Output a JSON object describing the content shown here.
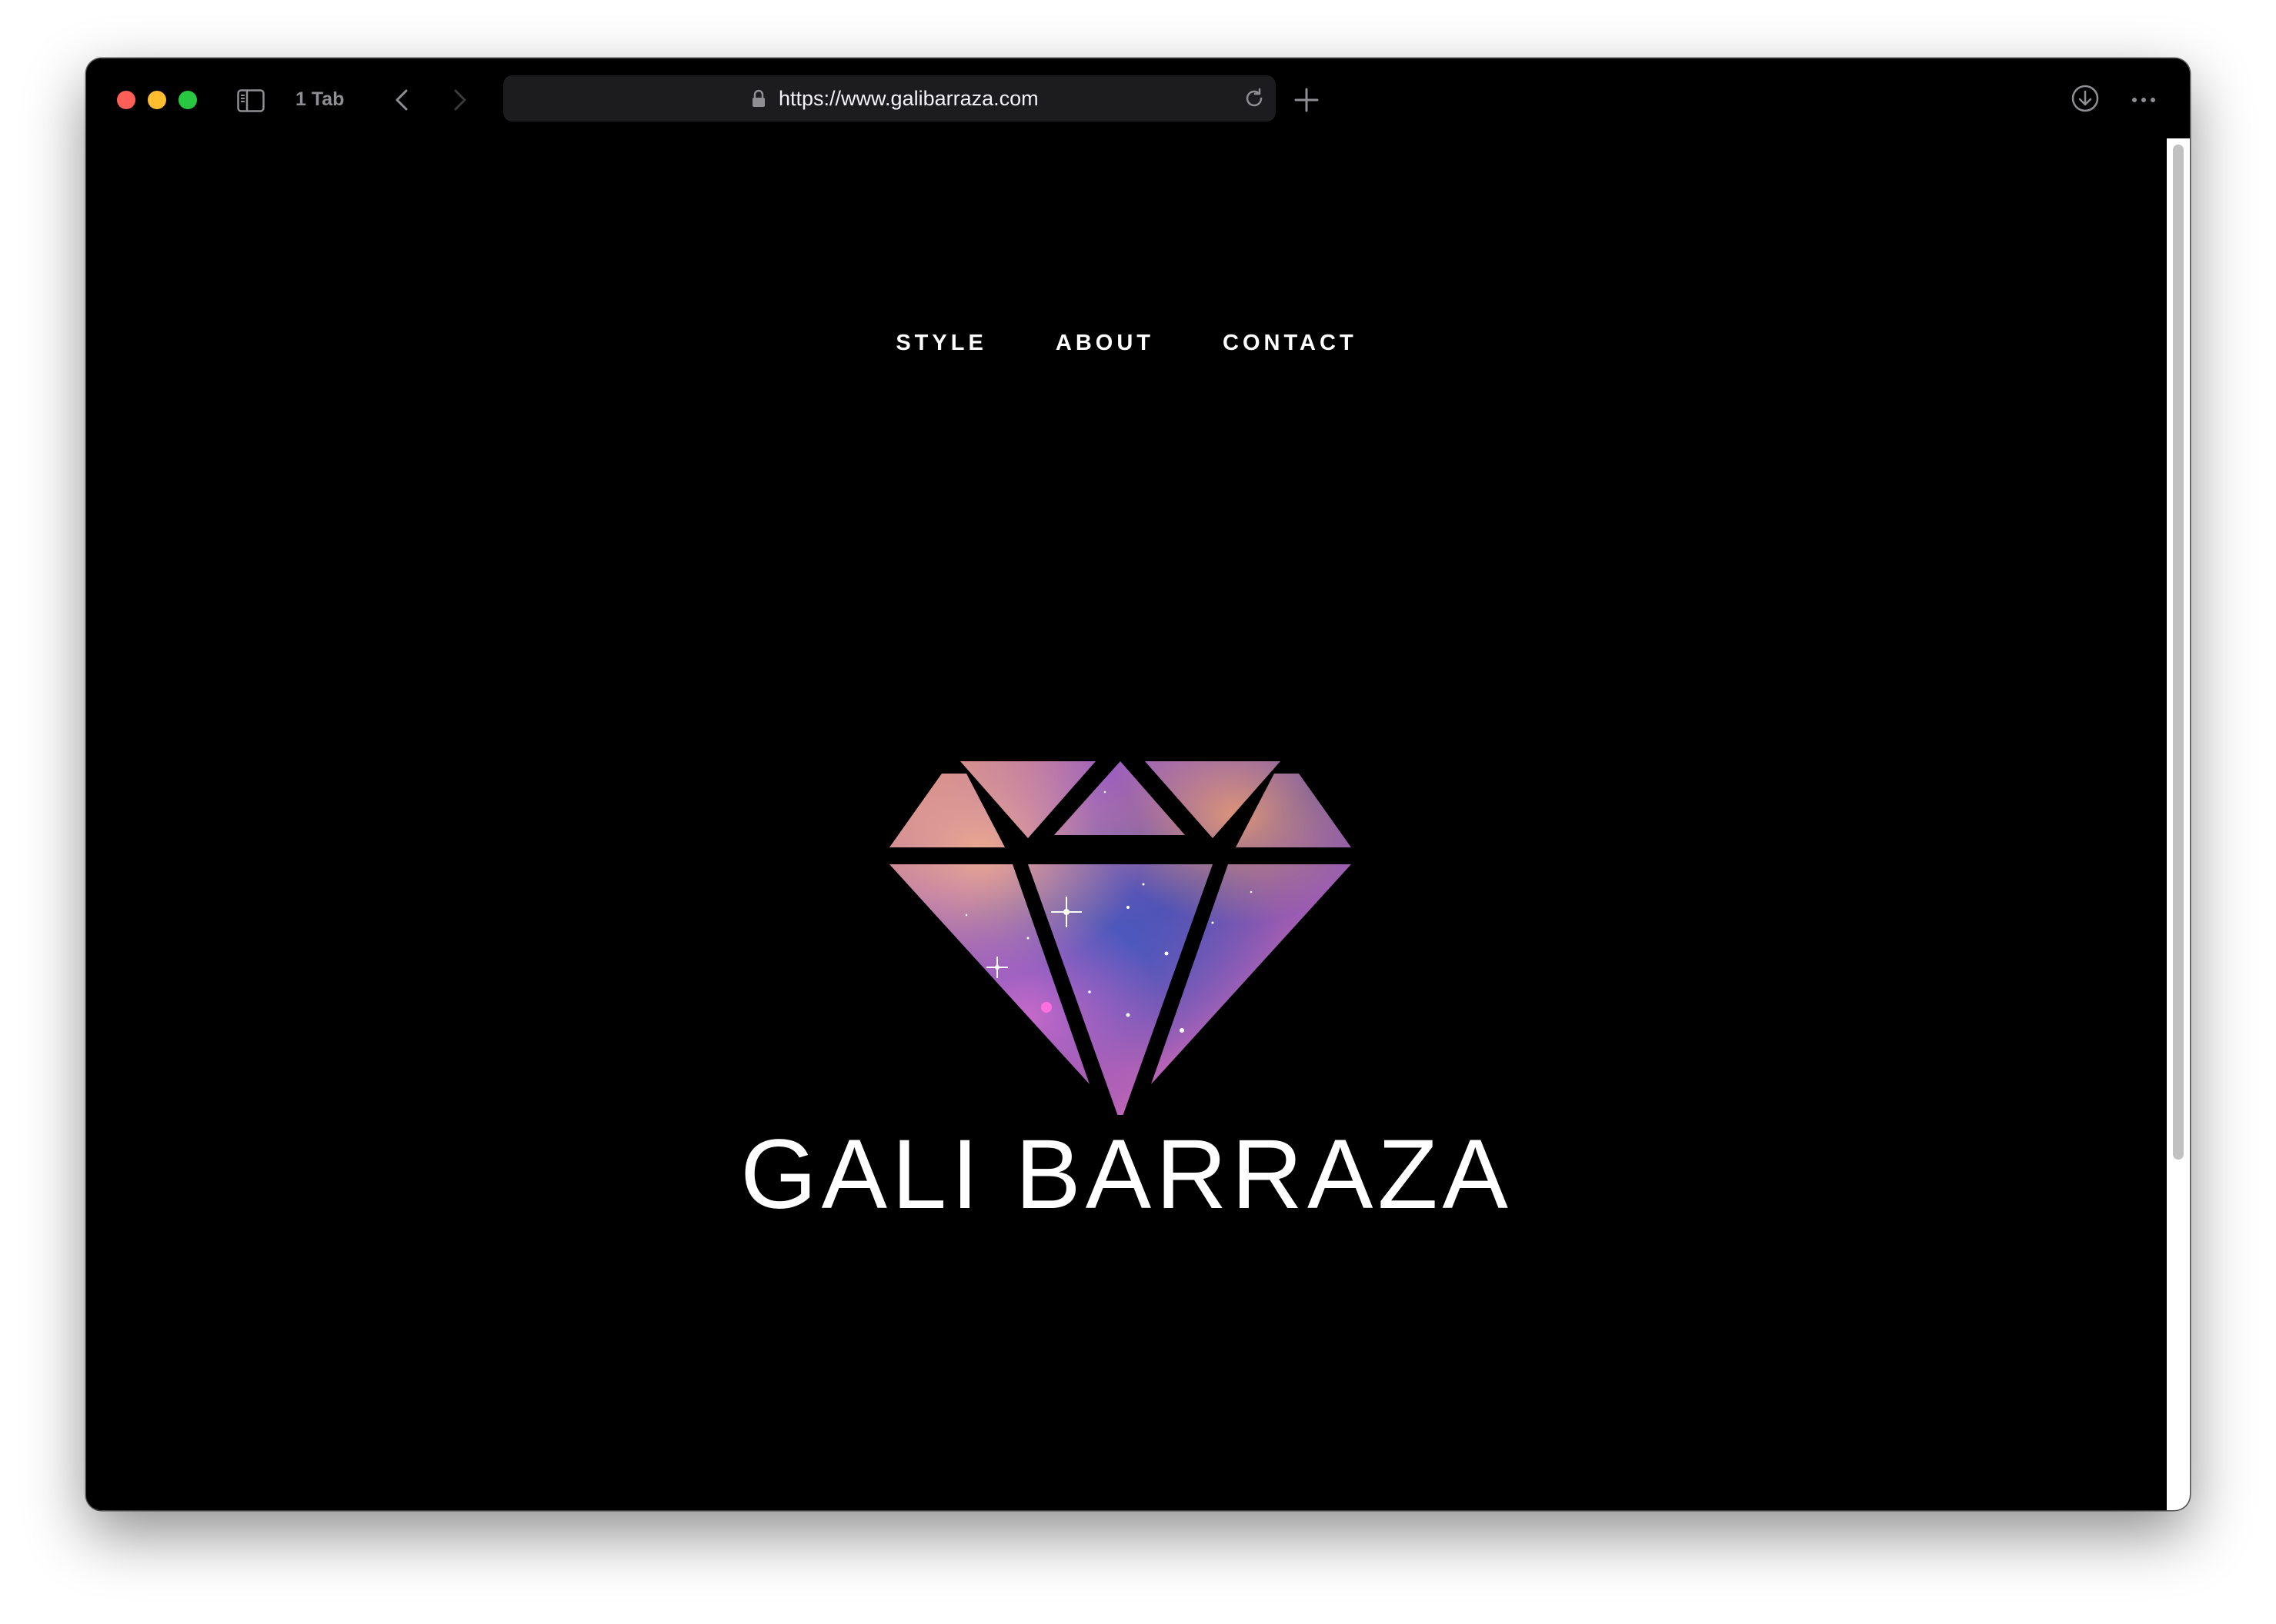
{
  "browser": {
    "tab_count_label": "1 Tab",
    "url": "https://www.galibarraza.com",
    "icons": {
      "sidebar": "sidebar-icon",
      "back": "chevron-left-icon",
      "forward": "chevron-right-icon",
      "lock": "lock-icon",
      "reload": "reload-icon",
      "new_tab": "plus-icon",
      "download": "download-icon",
      "more": "ellipsis-icon"
    }
  },
  "site": {
    "nav": [
      {
        "label": "STYLE"
      },
      {
        "label": "ABOUT"
      },
      {
        "label": "CONTACT"
      }
    ],
    "brand_name": "GALI BARRAZA",
    "colors": {
      "background": "#000000",
      "text": "#ffffff",
      "logo_galaxy_primary": "#7b4fb8",
      "logo_galaxy_secondary": "#d77cc4",
      "logo_galaxy_dust": "#e2967a"
    }
  }
}
